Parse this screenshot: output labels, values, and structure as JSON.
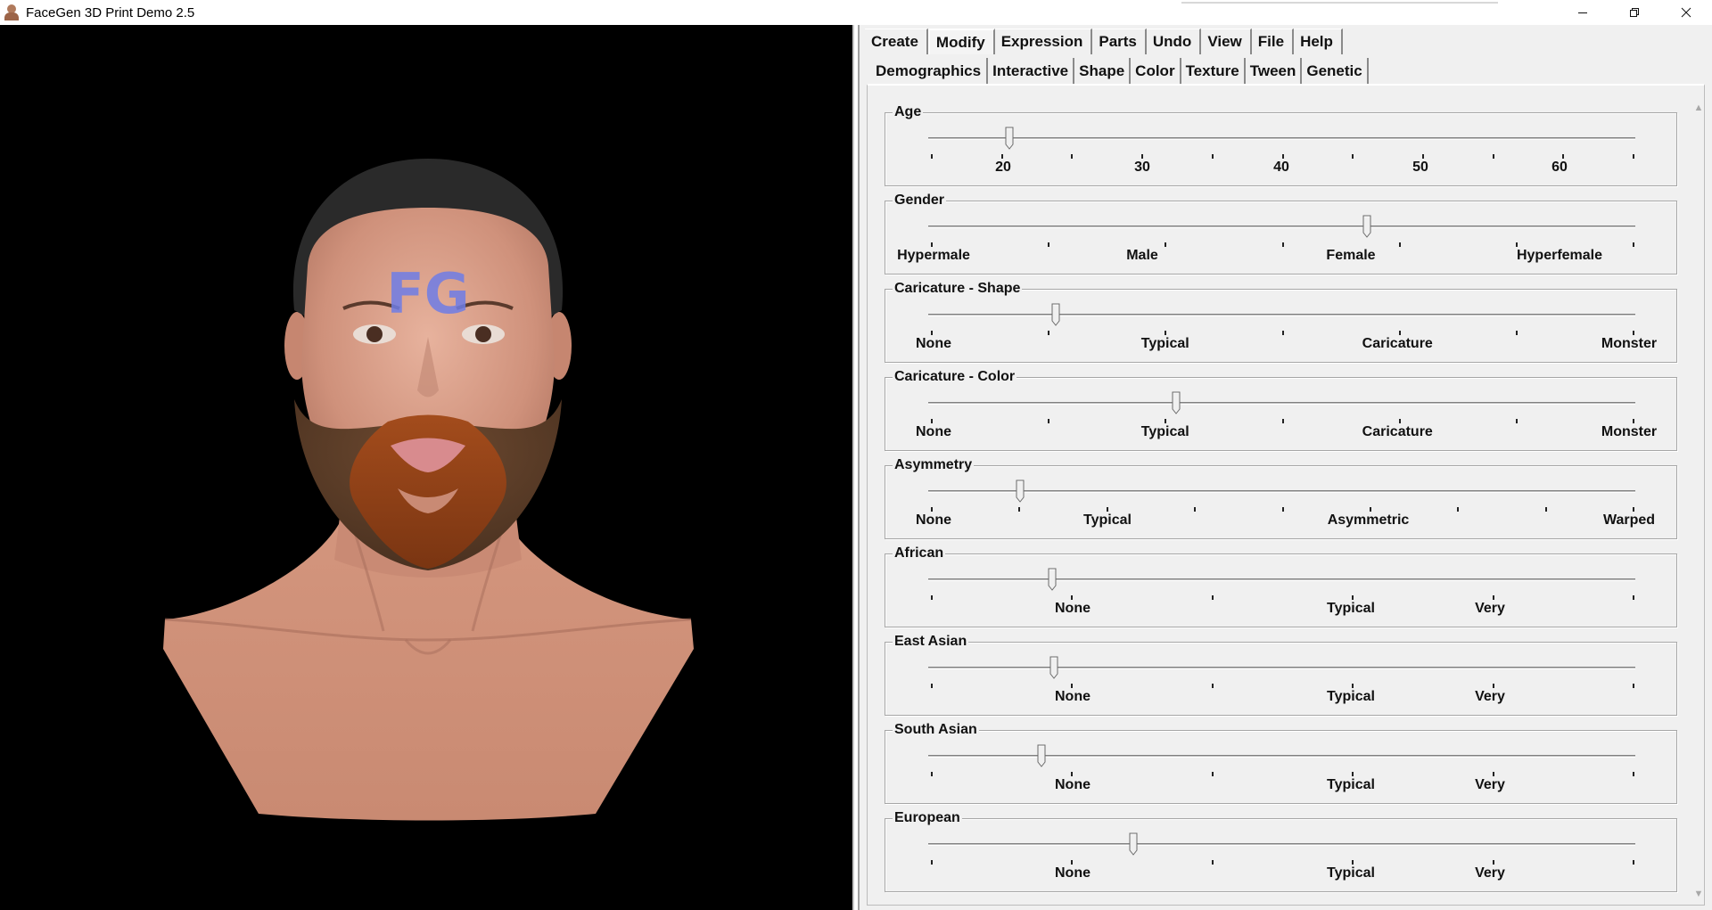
{
  "window": {
    "title": "FaceGen 3D Print Demo 2.5",
    "controls": [
      "minimize",
      "restore",
      "close"
    ]
  },
  "viewport": {
    "forehead_text": "FG",
    "background_color": "#000000"
  },
  "menu": {
    "tabs": [
      {
        "label": "Create",
        "active": false
      },
      {
        "label": "Modify",
        "active": true
      },
      {
        "label": "Expression",
        "active": false
      },
      {
        "label": "Parts",
        "active": false
      },
      {
        "label": "Undo",
        "active": false
      },
      {
        "label": "View",
        "active": false
      },
      {
        "label": "File",
        "active": false
      },
      {
        "label": "Help",
        "active": false
      }
    ]
  },
  "subtabs": [
    {
      "label": "Demographics",
      "active": true
    },
    {
      "label": "Interactive",
      "active": false
    },
    {
      "label": "Shape",
      "active": false
    },
    {
      "label": "Color",
      "active": false
    },
    {
      "label": "Texture",
      "active": false
    },
    {
      "label": "Tween",
      "active": false
    },
    {
      "label": "Genetic",
      "active": false
    }
  ],
  "sliders": [
    {
      "name": "age",
      "label": "Age",
      "value_fraction": 0.115,
      "tick_count": 11,
      "labels": [
        {
          "text": "20",
          "at": 0.1
        },
        {
          "text": "30",
          "at": 0.3
        },
        {
          "text": "40",
          "at": 0.5
        },
        {
          "text": "50",
          "at": 0.7
        },
        {
          "text": "60",
          "at": 0.9
        }
      ]
    },
    {
      "name": "gender",
      "label": "Gender",
      "value_fraction": 0.62,
      "tick_count": 7,
      "labels": [
        {
          "text": "Hypermale",
          "at": 0.0
        },
        {
          "text": "Male",
          "at": 0.3
        },
        {
          "text": "Female",
          "at": 0.6
        },
        {
          "text": "Hyperfemale",
          "at": 0.9
        }
      ]
    },
    {
      "name": "caricature-shape",
      "label": "Caricature - Shape",
      "value_fraction": 0.18,
      "tick_count": 7,
      "labels": [
        {
          "text": "None",
          "at": 0.0
        },
        {
          "text": "Typical",
          "at": 0.333
        },
        {
          "text": "Caricature",
          "at": 0.667
        },
        {
          "text": "Monster",
          "at": 1.0
        }
      ]
    },
    {
      "name": "caricature-color",
      "label": "Caricature - Color",
      "value_fraction": 0.35,
      "tick_count": 7,
      "labels": [
        {
          "text": "None",
          "at": 0.0
        },
        {
          "text": "Typical",
          "at": 0.333
        },
        {
          "text": "Caricature",
          "at": 0.667
        },
        {
          "text": "Monster",
          "at": 1.0
        }
      ]
    },
    {
      "name": "asymmetry",
      "label": "Asymmetry",
      "value_fraction": 0.13,
      "tick_count": 9,
      "labels": [
        {
          "text": "None",
          "at": 0.0
        },
        {
          "text": "Typical",
          "at": 0.25
        },
        {
          "text": "Asymmetric",
          "at": 0.625
        },
        {
          "text": "Warped",
          "at": 1.0
        }
      ]
    },
    {
      "name": "african",
      "label": "African",
      "value_fraction": 0.175,
      "tick_count": 6,
      "labels": [
        {
          "text": "None",
          "at": 0.2
        },
        {
          "text": "Typical",
          "at": 0.6
        },
        {
          "text": "Very",
          "at": 0.8
        }
      ]
    },
    {
      "name": "east-asian",
      "label": "East Asian",
      "value_fraction": 0.178,
      "tick_count": 6,
      "labels": [
        {
          "text": "None",
          "at": 0.2
        },
        {
          "text": "Typical",
          "at": 0.6
        },
        {
          "text": "Very",
          "at": 0.8
        }
      ]
    },
    {
      "name": "south-asian",
      "label": "South Asian",
      "value_fraction": 0.16,
      "tick_count": 6,
      "labels": [
        {
          "text": "None",
          "at": 0.2
        },
        {
          "text": "Typical",
          "at": 0.6
        },
        {
          "text": "Very",
          "at": 0.8
        }
      ]
    },
    {
      "name": "european",
      "label": "European",
      "value_fraction": 0.29,
      "tick_count": 6,
      "labels": [
        {
          "text": "None",
          "at": 0.2
        },
        {
          "text": "Typical",
          "at": 0.6
        },
        {
          "text": "Very",
          "at": 0.8
        }
      ]
    }
  ]
}
